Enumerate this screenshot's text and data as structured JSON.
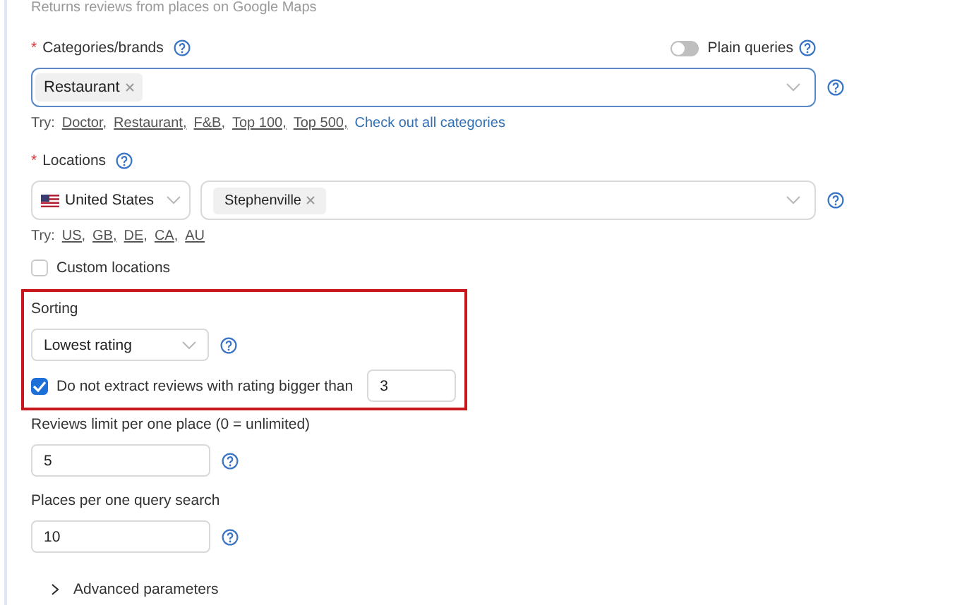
{
  "subtitle": "Returns reviews from places on Google Maps",
  "categories": {
    "required_mark": "*",
    "label": "Categories/brands",
    "tags": [
      "Restaurant"
    ],
    "plain_queries": {
      "label": "Plain queries",
      "on": false
    },
    "try_label": "Try:",
    "suggestions": [
      "Doctor,",
      "Restaurant,",
      "F&B,",
      "Top 100,",
      "Top 500,"
    ],
    "all_link": "Check out all categories"
  },
  "locations": {
    "required_mark": "*",
    "label": "Locations",
    "country": "United States",
    "tags": [
      "Stephenville"
    ],
    "try_label": "Try:",
    "suggestions": [
      "US,",
      "GB,",
      "DE,",
      "CA,",
      "AU"
    ]
  },
  "custom_locations": {
    "label": "Custom locations",
    "checked": false
  },
  "sorting": {
    "label": "Sorting",
    "value": "Lowest rating",
    "highlighted": true
  },
  "rating_filter": {
    "label": "Do not extract reviews with rating bigger than",
    "checked": true,
    "value": "3"
  },
  "reviews_limit": {
    "label": "Reviews limit per one place (0 = unlimited)",
    "value": "5"
  },
  "places_per_query": {
    "label": "Places per one query search",
    "value": "10"
  },
  "advanced": {
    "label": "Advanced parameters",
    "expanded": false
  }
}
